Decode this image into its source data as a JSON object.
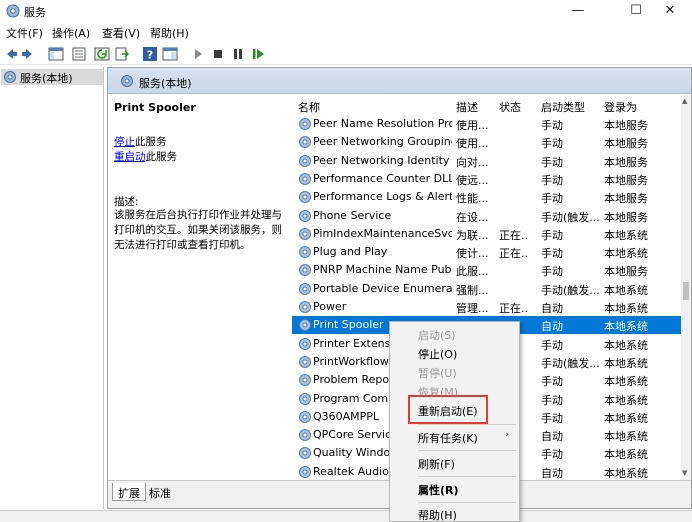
{
  "window": {
    "title": "服务",
    "minimize": "—",
    "maximize": "☐",
    "close": "✕"
  },
  "menu": [
    "文件(F)",
    "操作(A)",
    "查看(V)",
    "帮助(H)"
  ],
  "toolbar_icons": [
    "back-arrow-icon",
    "forward-arrow-icon",
    "console-tree-icon",
    "properties-sheet-icon",
    "refresh-icon",
    "export-list-icon",
    "help-icon",
    "show-hide-icon",
    "play-icon",
    "stop-icon",
    "pause-icon",
    "restart-icon"
  ],
  "left_pane": {
    "node": "服务(本地)"
  },
  "panel": {
    "header": "服务(本地)"
  },
  "description": {
    "service_name": "Print Spooler",
    "stop_link": "停止",
    "stop_suffix": "此服务",
    "restart_link": "重启动",
    "restart_suffix": "此服务",
    "label": "描述:",
    "text": "该服务在后台执行打印作业并处理与打印机的交互。如果关闭该服务，则无法进行打印或查看打印机。"
  },
  "columns": {
    "name": "名称",
    "desc": "描述",
    "status": "状态",
    "startup": "启动类型",
    "logon": "登录为"
  },
  "rows": [
    {
      "name": "Peer Name Resolution Pro...",
      "desc": "使用...",
      "status": "",
      "startup": "手动",
      "logon": "本地服务"
    },
    {
      "name": "Peer Networking Grouping",
      "desc": "使用...",
      "status": "",
      "startup": "手动",
      "logon": "本地服务"
    },
    {
      "name": "Peer Networking Identity ...",
      "desc": "向对...",
      "status": "",
      "startup": "手动",
      "logon": "本地服务"
    },
    {
      "name": "Performance Counter DLL ...",
      "desc": "使远...",
      "status": "",
      "startup": "手动",
      "logon": "本地服务"
    },
    {
      "name": "Performance Logs & Alerts",
      "desc": "性能...",
      "status": "",
      "startup": "手动",
      "logon": "本地服务"
    },
    {
      "name": "Phone Service",
      "desc": "在设...",
      "status": "",
      "startup": "手动(触发...",
      "logon": "本地服务"
    },
    {
      "name": "PimIndexMaintenanceSvc_...",
      "desc": "为联...",
      "status": "正在...",
      "startup": "手动",
      "logon": "本地系统"
    },
    {
      "name": "Plug and Play",
      "desc": "使计...",
      "status": "正在...",
      "startup": "手动",
      "logon": "本地系统"
    },
    {
      "name": "PNRP Machine Name Publ...",
      "desc": "此服...",
      "status": "",
      "startup": "手动",
      "logon": "本地服务"
    },
    {
      "name": "Portable Device Enumerat...",
      "desc": "强制...",
      "status": "",
      "startup": "手动(触发...",
      "logon": "本地系统"
    },
    {
      "name": "Power",
      "desc": "管理...",
      "status": "正在...",
      "startup": "自动",
      "logon": "本地系统"
    },
    {
      "name": "Print Spooler",
      "desc": "",
      "status": "",
      "startup": "自动",
      "logon": "本地系统"
    },
    {
      "name": "Printer Extensio",
      "desc": "",
      "status": "",
      "startup": "手动",
      "logon": "本地系统"
    },
    {
      "name": "PrintWorkflowU",
      "desc": "",
      "status": "",
      "startup": "手动(触发...",
      "logon": "本地系统"
    },
    {
      "name": "Problem Report",
      "desc": "",
      "status": "",
      "startup": "手动",
      "logon": "本地系统"
    },
    {
      "name": "Program Compa",
      "desc": "",
      "status": "",
      "startup": "手动",
      "logon": "本地系统"
    },
    {
      "name": "Q360AMPPL",
      "desc": "",
      "status": "",
      "startup": "手动",
      "logon": "本地系统"
    },
    {
      "name": "QPCore Service",
      "desc": "",
      "status": "",
      "startup": "自动",
      "logon": "本地系统"
    },
    {
      "name": "Quality Window",
      "desc": "",
      "status": "",
      "startup": "手动",
      "logon": "本地系统"
    },
    {
      "name": "Realtek Audio U",
      "desc": "",
      "status": "",
      "startup": "自动",
      "logon": "本地系统"
    }
  ],
  "tabs": [
    "扩展",
    "标准"
  ],
  "context_menu": {
    "start": "启动(S)",
    "stop": "停止(O)",
    "pause": "暂停(U)",
    "resume": "恢复(M)",
    "restart": "重新启动(E)",
    "all_tasks": "所有任务(K)",
    "submenu_arrow": "›",
    "refresh": "刷新(F)",
    "properties": "属性(R)",
    "help": "帮助(H)"
  },
  "colors": {
    "selection": "#0078d7",
    "link": "#0000ee",
    "highlight_box": "#e53935",
    "panel_header": "#d8e3f0"
  }
}
